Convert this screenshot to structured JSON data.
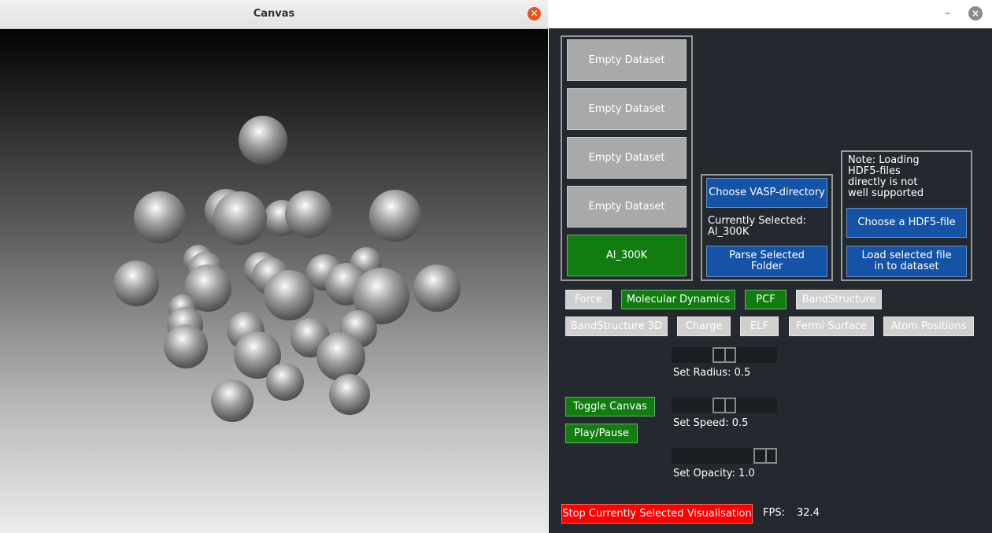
{
  "canvas_window": {
    "title": "Canvas",
    "close_icon": "close-icon",
    "accent_color": "#e95420"
  },
  "control_window": {
    "minimize_symbol": "–",
    "close_symbol": "×",
    "datasets": [
      "Empty Dataset",
      "Empty Dataset",
      "Empty Dataset",
      "Empty Dataset",
      "Al_300K"
    ],
    "selected_dataset": "Al_300K",
    "vasp": {
      "choose_label": "Choose VASP-directory",
      "currently_selected_label": "Currently Selected:",
      "currently_selected_value": "Al_300K",
      "parse_label": "Parse Selected\nFolder"
    },
    "hdf5": {
      "note": "Note: Loading\nHDF5-files\ndirectly is not\nwell supported",
      "choose_label": "Choose a HDF5-file",
      "load_label": "Load selected file\nin to dataset"
    },
    "vis_row1": [
      "Force",
      "Molecular Dynamics",
      "PCF",
      "BandStructure"
    ],
    "vis_row2": [
      "BandStructure 3D",
      "Charge",
      "ELF",
      "Fermi Surface",
      "Atom Positions"
    ],
    "active_visualisation": "PCF",
    "toggle_canvas_label": "Toggle Canvas",
    "play_pause_label": "Play/Pause",
    "sliders": {
      "radius_label": "Set Radius: 0.5",
      "radius_value": 0.5,
      "speed_label": "Set Speed: 0.5",
      "speed_value": 0.5,
      "opacity_label": "Set Opacity: 1.0",
      "opacity_value": 1.0
    },
    "stop_label": "Stop Currently Selected Visualisation",
    "fps_label": "FPS:",
    "fps_value": "32.4",
    "colors": {
      "panel_bg": "#24292f",
      "green": "#117d11",
      "blue": "#1553a6",
      "grey": "#a9a9a9",
      "red": "#ff0000"
    }
  }
}
